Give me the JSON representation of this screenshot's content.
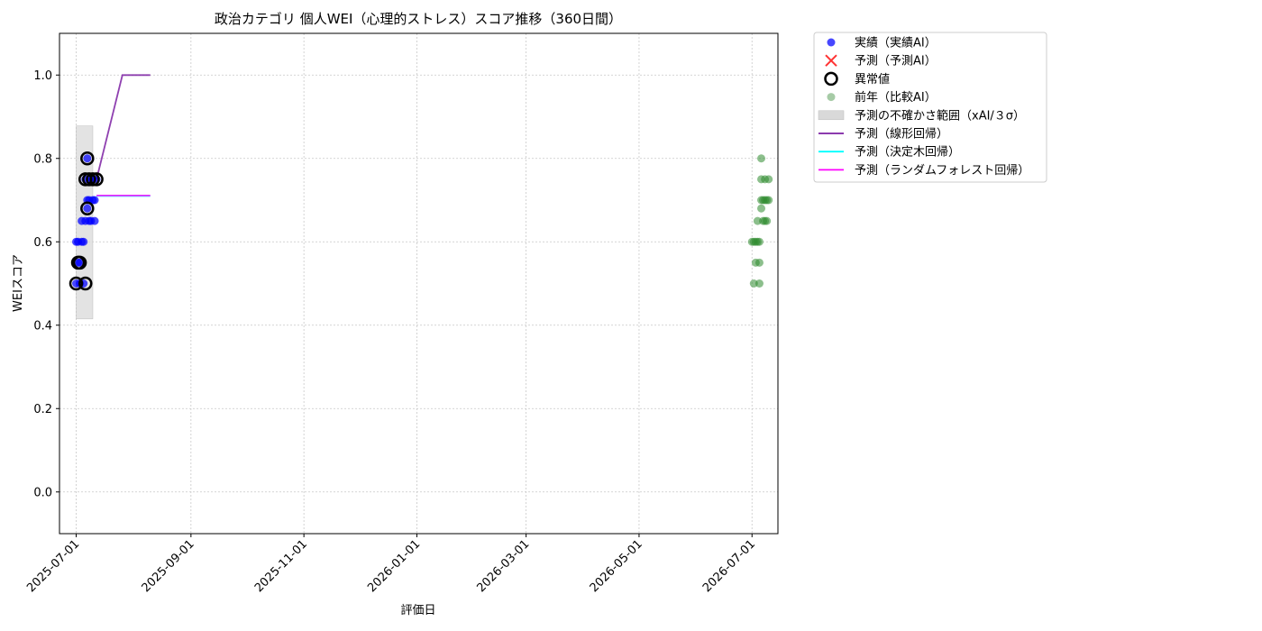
{
  "chart_data": {
    "type": "scatter",
    "title": "政治カテゴリ 個人WEI（心理的ストレス）スコア推移（360日間）",
    "xlabel": "評価日",
    "ylabel": "WEIスコア",
    "xlim": [
      "2025-06-22",
      "2026-07-15"
    ],
    "ylim": [
      -0.1,
      1.1
    ],
    "x_ticks": [
      "2025-07-01",
      "2025-09-01",
      "2025-11-01",
      "2026-01-01",
      "2026-03-01",
      "2026-05-01",
      "2026-07-01"
    ],
    "y_ticks": [
      0.0,
      0.2,
      0.4,
      0.6,
      0.8,
      1.0
    ],
    "y_tick_labels": [
      "0.0",
      "0.2",
      "0.4",
      "0.6",
      "0.8",
      "1.0"
    ],
    "grid": true,
    "legend_position": "outside-right",
    "legend": [
      {
        "label": "実績（実績AI）",
        "marker": "dot",
        "color": "#0000ff"
      },
      {
        "label": "予測（予測AI）",
        "marker": "x",
        "color": "#ff3333"
      },
      {
        "label": "異常値",
        "marker": "ring",
        "color": "#000000"
      },
      {
        "label": "前年（比較AI）",
        "marker": "dot",
        "color": "#6aa86a"
      },
      {
        "label": "予測の不確かさ範囲（xAI/３σ）",
        "marker": "band",
        "color": "#d9d9d9"
      },
      {
        "label": "予測（線形回帰）",
        "marker": "line",
        "color": "#7b1fa2"
      },
      {
        "label": "予測（決定木回帰）",
        "marker": "line",
        "color": "#00ffff"
      },
      {
        "label": "予測（ランダムフォレスト回帰）",
        "marker": "line",
        "color": "#ff00ff"
      }
    ],
    "series": [
      {
        "name": "実績（実績AI）",
        "color": "#0000ff",
        "points": [
          [
            "2025-07-01",
            0.5
          ],
          [
            "2025-07-01",
            0.6
          ],
          [
            "2025-07-02",
            0.55
          ],
          [
            "2025-07-02",
            0.6
          ],
          [
            "2025-07-03",
            0.5
          ],
          [
            "2025-07-03",
            0.55
          ],
          [
            "2025-07-04",
            0.6
          ],
          [
            "2025-07-04",
            0.65
          ],
          [
            "2025-07-05",
            0.5
          ],
          [
            "2025-07-05",
            0.6
          ],
          [
            "2025-07-06",
            0.75
          ],
          [
            "2025-07-06",
            0.65
          ],
          [
            "2025-07-07",
            0.68
          ],
          [
            "2025-07-07",
            0.7
          ],
          [
            "2025-07-07",
            0.8
          ],
          [
            "2025-07-08",
            0.7
          ],
          [
            "2025-07-08",
            0.65
          ],
          [
            "2025-07-09",
            0.75
          ],
          [
            "2025-07-09",
            0.65
          ],
          [
            "2025-07-10",
            0.7
          ],
          [
            "2025-07-10",
            0.75
          ],
          [
            "2025-07-11",
            0.65
          ],
          [
            "2025-07-11",
            0.7
          ],
          [
            "2025-07-12",
            0.75
          ]
        ]
      },
      {
        "name": "異常値",
        "color": "#000000",
        "points": [
          [
            "2025-07-01",
            0.5
          ],
          [
            "2025-07-02",
            0.55
          ],
          [
            "2025-07-03",
            0.55
          ],
          [
            "2025-07-06",
            0.5
          ],
          [
            "2025-07-06",
            0.75
          ],
          [
            "2025-07-07",
            0.68
          ],
          [
            "2025-07-07",
            0.8
          ],
          [
            "2025-07-08",
            0.75
          ],
          [
            "2025-07-10",
            0.75
          ],
          [
            "2025-07-12",
            0.75
          ]
        ]
      },
      {
        "name": "前年（比較AI）",
        "color": "#2e8b2e",
        "points": [
          [
            "2026-07-01",
            0.6
          ],
          [
            "2026-07-02",
            0.5
          ],
          [
            "2026-07-02",
            0.6
          ],
          [
            "2026-07-03",
            0.55
          ],
          [
            "2026-07-03",
            0.6
          ],
          [
            "2026-07-04",
            0.65
          ],
          [
            "2026-07-04",
            0.6
          ],
          [
            "2026-07-05",
            0.5
          ],
          [
            "2026-07-05",
            0.55
          ],
          [
            "2026-07-05",
            0.6
          ],
          [
            "2026-07-06",
            0.68
          ],
          [
            "2026-07-06",
            0.7
          ],
          [
            "2026-07-06",
            0.8
          ],
          [
            "2026-07-06",
            0.75
          ],
          [
            "2026-07-07",
            0.7
          ],
          [
            "2026-07-07",
            0.65
          ],
          [
            "2026-07-08",
            0.75
          ],
          [
            "2026-07-08",
            0.7
          ],
          [
            "2026-07-08",
            0.65
          ],
          [
            "2026-07-09",
            0.7
          ],
          [
            "2026-07-09",
            0.65
          ],
          [
            "2026-07-10",
            0.75
          ],
          [
            "2026-07-10",
            0.7
          ]
        ]
      },
      {
        "name": "予測（線形回帰）",
        "color": "#7b1fa2",
        "line": [
          [
            "2025-07-12",
            0.75
          ],
          [
            "2025-07-26",
            1.0
          ],
          [
            "2025-08-10",
            1.0
          ]
        ]
      },
      {
        "name": "予測（決定木回帰）",
        "color": "#00ffff",
        "line": [
          [
            "2025-07-12",
            0.71
          ],
          [
            "2025-08-10",
            0.71
          ]
        ]
      },
      {
        "name": "予測（ランダムフォレスト回帰）",
        "color": "#ff00ff",
        "line": [
          [
            "2025-07-12",
            0.711
          ],
          [
            "2025-08-10",
            0.711
          ]
        ]
      }
    ],
    "uncertainty_band": {
      "x_range": [
        "2025-07-01",
        "2025-07-10"
      ],
      "y_range": [
        0.415,
        0.878
      ],
      "color": "#d9d9d9"
    }
  }
}
